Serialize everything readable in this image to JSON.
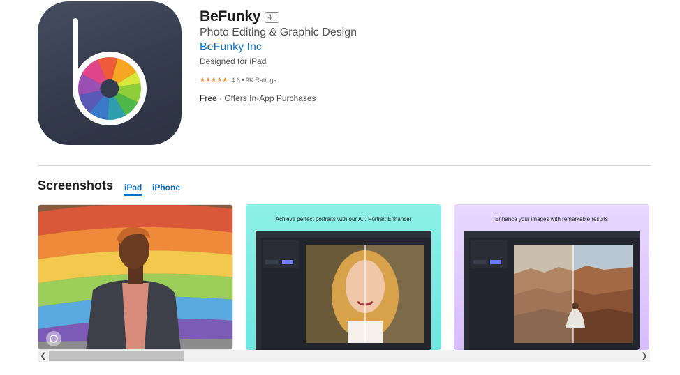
{
  "app": {
    "title": "BeFunky",
    "age_rating": "4+",
    "subtitle": "Photo Editing & Graphic Design",
    "developer": "BeFunky Inc",
    "designed_for": "Designed for iPad",
    "stars": "★★★★★",
    "rating_text": "4.6 • 9K Ratings",
    "price": "Free",
    "price_note": " · Offers In-App Purchases"
  },
  "screenshots": {
    "heading": "Screenshots",
    "tabs": [
      {
        "label": "iPad",
        "selected": true
      },
      {
        "label": "iPhone",
        "selected": false
      }
    ],
    "items": [
      {
        "caption": ""
      },
      {
        "caption": "Achieve perfect portraits with our A.I. Portrait Enhancer"
      },
      {
        "caption": "Enhance your images with remarkable results"
      }
    ]
  },
  "colors": {
    "accent": "#0a6ec7",
    "star": "#f08a24",
    "icon_bg": "#3a4152"
  }
}
